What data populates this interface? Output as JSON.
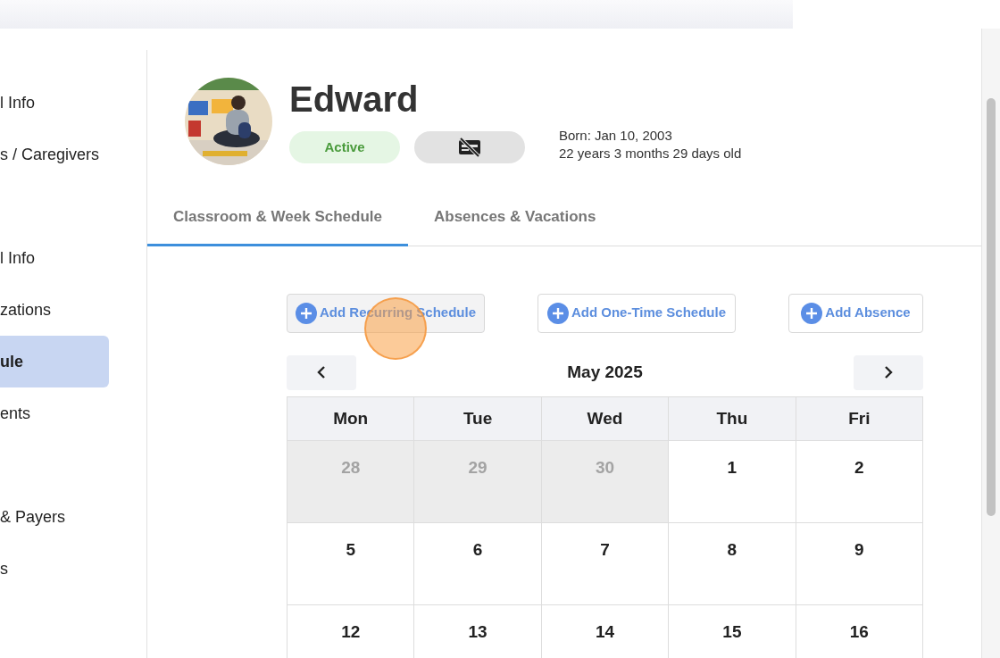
{
  "sidebar": {
    "groups": [
      [
        {
          "label": "l Info",
          "selected": false
        },
        {
          "label": "s / Caregivers",
          "selected": false
        }
      ],
      [
        {
          "label": "l Info",
          "selected": false
        },
        {
          "label": "zations",
          "selected": false
        },
        {
          "label": "ule",
          "selected": true
        },
        {
          "label": "ents",
          "selected": false
        }
      ],
      [
        {
          "label": "& Payers",
          "selected": false
        },
        {
          "label": "s",
          "selected": false
        }
      ]
    ]
  },
  "profile": {
    "name": "Edward",
    "status": "Active",
    "born": "Born: Jan 10, 2003",
    "age": "22 years 3 months 29 days old"
  },
  "tabs": [
    {
      "label": "Classroom & Week Schedule",
      "selected": true
    },
    {
      "label": "Absences & Vacations",
      "selected": false
    }
  ],
  "actions": [
    {
      "label": "Add Recurring Schedule",
      "hovered": true
    },
    {
      "label": "Add One-Time Schedule",
      "hovered": false
    },
    {
      "label": "Add Absence",
      "hovered": false
    }
  ],
  "calendar": {
    "title": "May 2025",
    "weekdays": [
      "Mon",
      "Tue",
      "Wed",
      "Thu",
      "Fri"
    ],
    "weeks": [
      [
        {
          "day": "28",
          "outside": true
        },
        {
          "day": "29",
          "outside": true
        },
        {
          "day": "30",
          "outside": true
        },
        {
          "day": "1",
          "outside": false
        },
        {
          "day": "2",
          "outside": false
        }
      ],
      [
        {
          "day": "5",
          "outside": false
        },
        {
          "day": "6",
          "outside": false
        },
        {
          "day": "7",
          "outside": false
        },
        {
          "day": "8",
          "outside": false
        },
        {
          "day": "9",
          "outside": false
        }
      ],
      [
        {
          "day": "12",
          "outside": false
        },
        {
          "day": "13",
          "outside": false
        },
        {
          "day": "14",
          "outside": false
        },
        {
          "day": "15",
          "outside": false
        },
        {
          "day": "16",
          "outside": false
        }
      ]
    ]
  }
}
